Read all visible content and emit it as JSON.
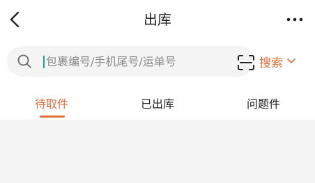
{
  "header": {
    "title": "出库",
    "back_icon": "chevron-left-icon",
    "more_icon": "more-dots-icon"
  },
  "search": {
    "placeholder": "包裹编号/手机尾号/运单号",
    "value": "",
    "scan_icon": "scan-icon",
    "button_label": "搜索",
    "dropdown_icon": "chevron-down-icon",
    "accent_color": "#e2703a"
  },
  "tabs": [
    {
      "label": "待取件",
      "active": true
    },
    {
      "label": "已出库",
      "active": false
    },
    {
      "label": "问题件",
      "active": false
    }
  ]
}
